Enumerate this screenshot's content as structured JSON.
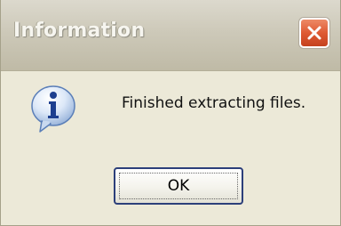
{
  "dialog": {
    "title": "Information",
    "message": "Finished extracting files.",
    "icon": "information-icon",
    "ok_label": "OK",
    "close_icon": "close-icon"
  },
  "colors": {
    "titlebar": "#cdc9b9",
    "title_text": "#f6f5ef",
    "close_button": "#df5a33",
    "dialog_background": "#ece9d8",
    "ok_border": "#2c3f7a"
  }
}
